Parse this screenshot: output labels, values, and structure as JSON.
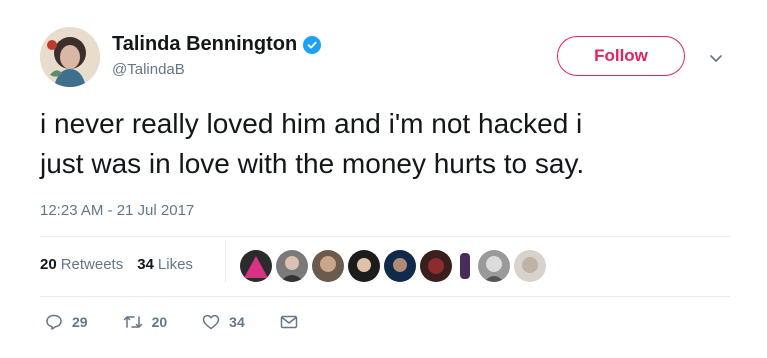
{
  "user": {
    "display_name": "Talinda Bennington",
    "handle": "@TalindaB",
    "verified": true,
    "follow_label": "Follow"
  },
  "tweet": {
    "text": "i never really loved him and i'm not hacked i\njust was in love with the money hurts to say.",
    "timestamp": "12:23 AM - 21 Jul 2017"
  },
  "stats": {
    "retweets_count": "20",
    "retweets_label": "Retweets",
    "likes_count": "34",
    "likes_label": "Likes"
  },
  "likers": [
    {
      "icon": "avatar-1"
    },
    {
      "icon": "avatar-2"
    },
    {
      "icon": "avatar-3"
    },
    {
      "icon": "avatar-4"
    },
    {
      "icon": "avatar-5"
    },
    {
      "icon": "avatar-6"
    },
    {
      "icon": "avatar-7"
    },
    {
      "icon": "avatar-8"
    },
    {
      "icon": "avatar-9"
    }
  ],
  "actions": {
    "reply_count": "29",
    "retweet_count": "20",
    "like_count": "34"
  },
  "colors": {
    "follow_accent": "#e0245e",
    "verified_badge": "#1da1f2",
    "secondary_text": "#657786"
  }
}
